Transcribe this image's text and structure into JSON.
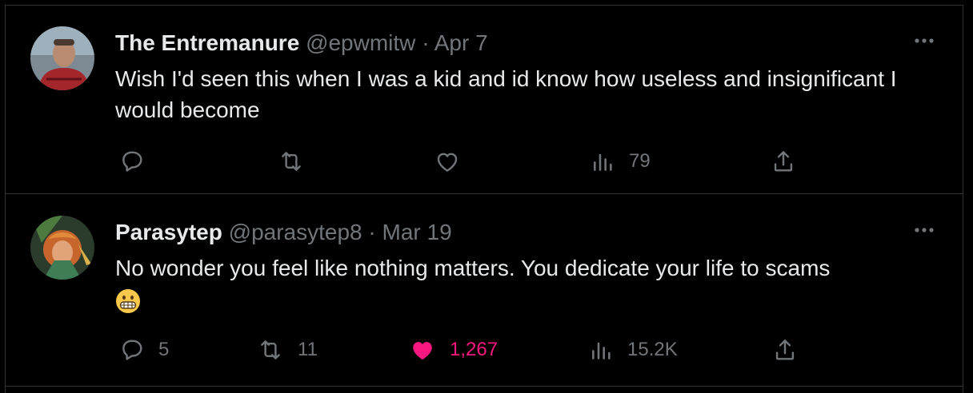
{
  "tweets": [
    {
      "display_name": "The Entremanure",
      "handle": "@epwmitw",
      "separator": "·",
      "date": "Apr 7",
      "text": "Wish I'd seen this when I was a kid and id know how useless and insignificant I would become",
      "emoji": "",
      "replies": "",
      "retweets": "",
      "likes": "",
      "liked": false,
      "views": "79",
      "icons": {
        "reply": "reply-icon",
        "retweet": "retweet-icon",
        "like": "heart-outline-icon",
        "views": "views-chart-icon",
        "share": "share-icon",
        "more": "more-dots-icon"
      }
    },
    {
      "display_name": "Parasytep",
      "handle": "@parasytep8",
      "separator": "·",
      "date": "Mar 19",
      "text": "No wonder you feel like nothing matters. You dedicate your life to scams",
      "emoji": "grimacing-face",
      "replies": "5",
      "retweets": "11",
      "likes": "1,267",
      "liked": true,
      "views": "15.2K",
      "icons": {
        "reply": "reply-icon",
        "retweet": "retweet-icon",
        "like": "heart-filled-icon",
        "views": "views-chart-icon",
        "share": "share-icon",
        "more": "more-dots-icon"
      }
    }
  ],
  "colors": {
    "background": "#000000",
    "text_primary": "#e7e9ea",
    "text_secondary": "#71767b",
    "border": "#2f3336",
    "like_active": "#f91880"
  }
}
